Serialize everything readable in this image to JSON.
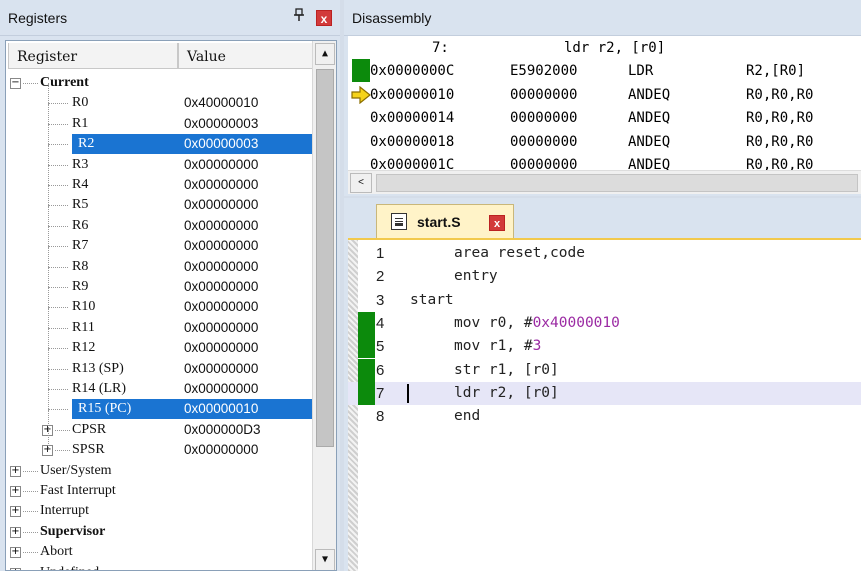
{
  "registers_pane": {
    "title": "Registers",
    "pin_glyph": "p",
    "close_glyph": "x",
    "columns": [
      "Register",
      "Value"
    ],
    "rows": [
      {
        "name": "Current",
        "value": "",
        "level": 0,
        "expander": "−",
        "bold": true
      },
      {
        "name": "R0",
        "value": "0x40000010",
        "level": 1
      },
      {
        "name": "R1",
        "value": "0x00000003",
        "level": 1
      },
      {
        "name": "R2",
        "value": "0x00000003",
        "level": 1,
        "selected": true
      },
      {
        "name": "R3",
        "value": "0x00000000",
        "level": 1
      },
      {
        "name": "R4",
        "value": "0x00000000",
        "level": 1
      },
      {
        "name": "R5",
        "value": "0x00000000",
        "level": 1
      },
      {
        "name": "R6",
        "value": "0x00000000",
        "level": 1
      },
      {
        "name": "R7",
        "value": "0x00000000",
        "level": 1
      },
      {
        "name": "R8",
        "value": "0x00000000",
        "level": 1
      },
      {
        "name": "R9",
        "value": "0x00000000",
        "level": 1
      },
      {
        "name": "R10",
        "value": "0x00000000",
        "level": 1
      },
      {
        "name": "R11",
        "value": "0x00000000",
        "level": 1
      },
      {
        "name": "R12",
        "value": "0x00000000",
        "level": 1
      },
      {
        "name": "R13 (SP)",
        "value": "0x00000000",
        "level": 1
      },
      {
        "name": "R14 (LR)",
        "value": "0x00000000",
        "level": 1
      },
      {
        "name": "R15 (PC)",
        "value": "0x00000010",
        "level": 1,
        "selected": true
      },
      {
        "name": "CPSR",
        "value": "0x000000D3",
        "level": 1,
        "expander": "+"
      },
      {
        "name": "SPSR",
        "value": "0x00000000",
        "level": 1,
        "expander": "+"
      },
      {
        "name": "User/System",
        "value": "",
        "level": 0,
        "expander": "+"
      },
      {
        "name": "Fast Interrupt",
        "value": "",
        "level": 0,
        "expander": "+"
      },
      {
        "name": "Interrupt",
        "value": "",
        "level": 0,
        "expander": "+"
      },
      {
        "name": "Supervisor",
        "value": "",
        "level": 0,
        "expander": "+",
        "bold": true
      },
      {
        "name": "Abort",
        "value": "",
        "level": 0,
        "expander": "+"
      },
      {
        "name": "Undefined",
        "value": "",
        "level": 0,
        "expander": "+"
      }
    ]
  },
  "disassembly_pane": {
    "title": "Disassembly",
    "source_line": {
      "num": "7:",
      "text": "ldr r2, [r0]"
    },
    "lines": [
      {
        "addr": "0x0000000C",
        "opcode": "E5902000",
        "mnemonic": "LDR",
        "operands": "R2,[R0]",
        "marker": "executed"
      },
      {
        "addr": "0x00000010",
        "opcode": "00000000",
        "mnemonic": "ANDEQ",
        "operands": "R0,R0,R0",
        "marker": "current-arrow"
      },
      {
        "addr": "0x00000014",
        "opcode": "00000000",
        "mnemonic": "ANDEQ",
        "operands": "R0,R0,R0",
        "marker": ""
      },
      {
        "addr": "0x00000018",
        "opcode": "00000000",
        "mnemonic": "ANDEQ",
        "operands": "R0,R0,R0",
        "marker": ""
      },
      {
        "addr": "0x0000001C",
        "opcode": "00000000",
        "mnemonic": "ANDEQ",
        "operands": "R0,R0,R0",
        "marker": ""
      }
    ],
    "scroll_left_glyph": "<"
  },
  "editor": {
    "tab_label": "start.S",
    "tab_close_glyph": "x",
    "lines": [
      {
        "num": "1",
        "indent": true,
        "tokens": [
          {
            "t": "area reset,code"
          }
        ]
      },
      {
        "num": "2",
        "indent": true,
        "tokens": [
          {
            "t": "entry"
          }
        ]
      },
      {
        "num": "3",
        "indent": false,
        "tokens": [
          {
            "t": "start"
          }
        ]
      },
      {
        "num": "4",
        "indent": true,
        "executed": true,
        "tokens": [
          {
            "t": "mov r0, #"
          },
          {
            "t": "0x40000010",
            "num": true
          }
        ]
      },
      {
        "num": "5",
        "indent": true,
        "executed": true,
        "tokens": [
          {
            "t": "mov r1, #"
          },
          {
            "t": "3",
            "num": true
          }
        ]
      },
      {
        "num": "6",
        "indent": true,
        "executed": true,
        "tokens": [
          {
            "t": "str r1, [r0]"
          }
        ]
      },
      {
        "num": "7",
        "indent": true,
        "executed": true,
        "current": true,
        "tokens": [
          {
            "t": "ldr r2, [r0]"
          }
        ]
      },
      {
        "num": "8",
        "indent": true,
        "tokens": [
          {
            "t": "end"
          }
        ]
      }
    ]
  },
  "colors": {
    "selection": "#1a74d2",
    "executed_marker": "#0c8a0c",
    "immediate": "#9b2aa3",
    "arrow": "#f5d31a"
  }
}
